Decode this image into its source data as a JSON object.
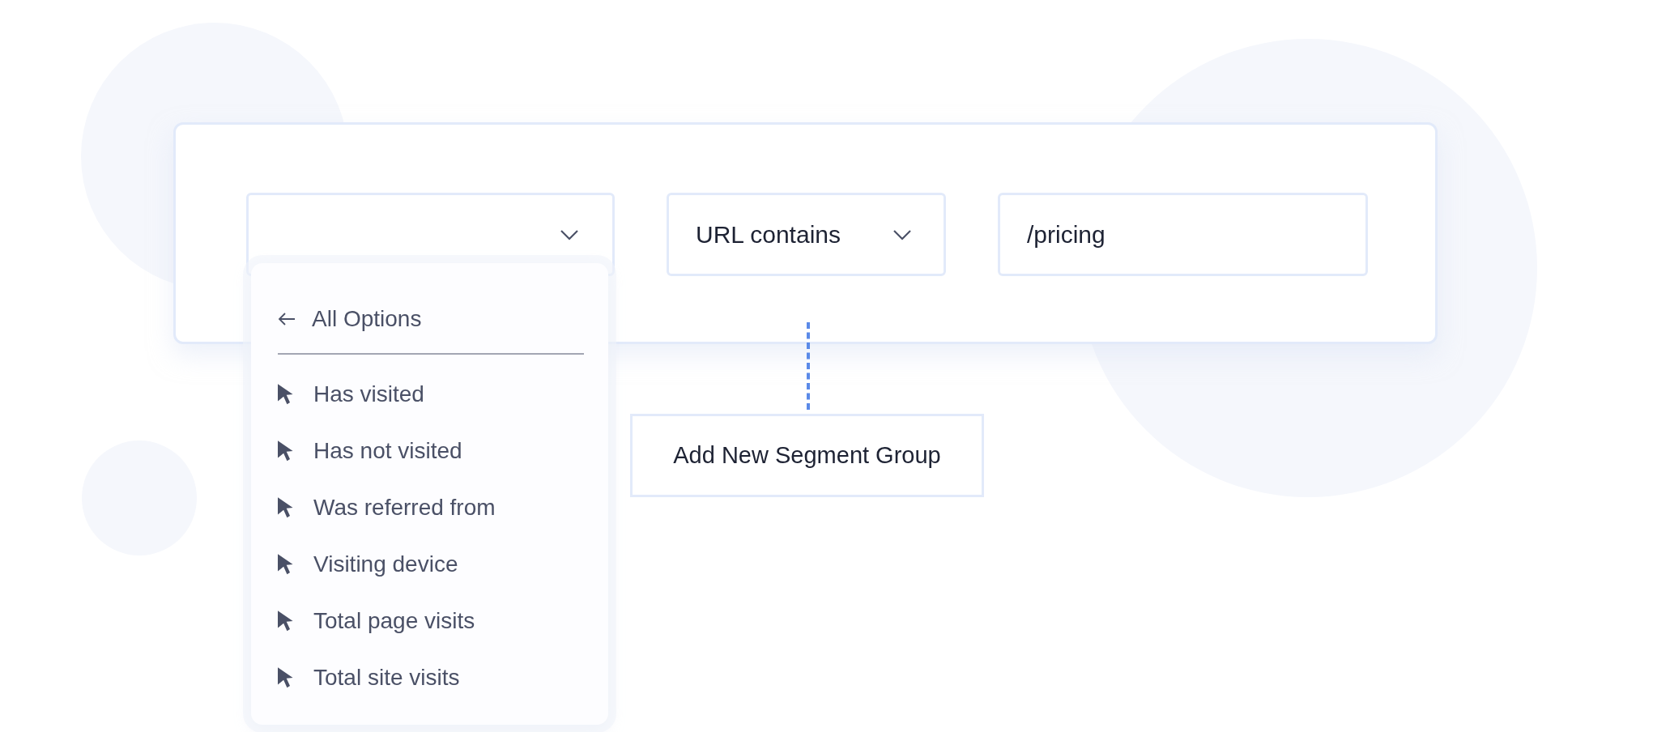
{
  "filter_row": {
    "fields": [
      {
        "kind": "select"
      },
      {
        "kind": "select",
        "value": "URL contains"
      },
      {
        "kind": "text",
        "value": "/pricing"
      }
    ]
  },
  "dropdown_menu": {
    "back_label": "All Options",
    "items": [
      "Has visited",
      "Has not visited",
      "Was referred from",
      "Visiting device",
      "Total page visits",
      "Total site visits"
    ]
  },
  "add_button": {
    "label": "Add New Segment Group"
  }
}
